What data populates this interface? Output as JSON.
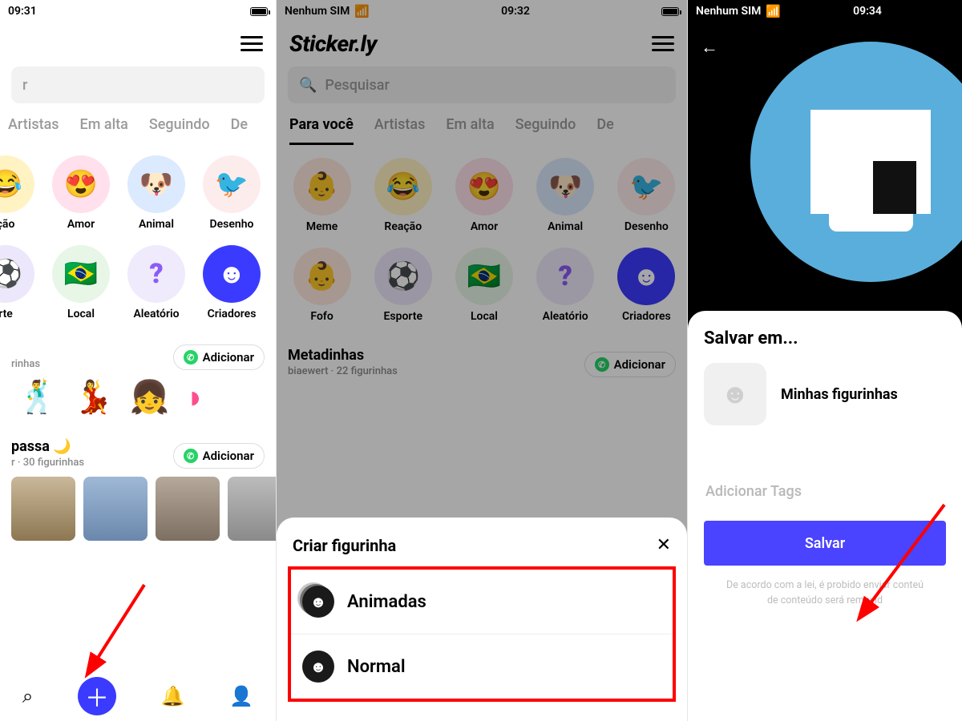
{
  "screen1": {
    "status_time": "09:31",
    "search_placeholder": "r",
    "tabs": [
      "Artistas",
      "Em alta",
      "Seguindo",
      "De"
    ],
    "cats_row1": [
      {
        "label": "ção"
      },
      {
        "label": "Amor"
      },
      {
        "label": "Animal"
      },
      {
        "label": "Desenho"
      }
    ],
    "cats_row2": [
      {
        "label": "rte"
      },
      {
        "label": "Local"
      },
      {
        "label": "Aleatório"
      },
      {
        "label": "Criadores"
      }
    ],
    "pack1_title": "rinhas",
    "add_label": "Adicionar",
    "pack2_title": "passa 🌙",
    "pack2_sub": "r · 30 figurinhas"
  },
  "screen2": {
    "carrier": "Nenhum SIM",
    "status_time": "09:32",
    "logo": "Sticker.ly",
    "search_placeholder": "Pesquisar",
    "tabs": [
      "Para você",
      "Artistas",
      "Em alta",
      "Seguindo",
      "De"
    ],
    "cats_row1": [
      {
        "label": "Meme"
      },
      {
        "label": "Reação"
      },
      {
        "label": "Amor"
      },
      {
        "label": "Animal"
      },
      {
        "label": "Desenho"
      }
    ],
    "cats_row2": [
      {
        "label": "Fofo"
      },
      {
        "label": "Esporte"
      },
      {
        "label": "Local"
      },
      {
        "label": "Aleatório"
      },
      {
        "label": "Criadores"
      }
    ],
    "pack_title": "Metadinhas",
    "pack_sub": "biaewert · 22 figurinhas",
    "add_label": "Adicionar",
    "sheet_title": "Criar figurinha",
    "opt1": "Animadas",
    "opt2": "Normal"
  },
  "screen3": {
    "carrier": "Nenhum SIM",
    "status_time": "09:34",
    "sheet_title": "Salvar em...",
    "dest_label": "Minhas figurinhas",
    "tags_placeholder": "Adicionar Tags",
    "save_label": "Salvar",
    "legal1": "De acordo com a lei, é probido enviar conteú",
    "legal2": "de conteúdo será removid"
  }
}
